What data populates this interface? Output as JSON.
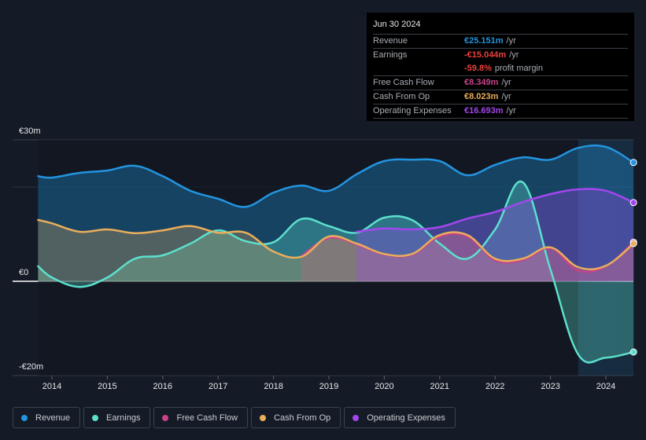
{
  "tooltip": {
    "date": "Jun 30 2024",
    "rows": [
      {
        "label": "Revenue",
        "value": "€25.151m",
        "unit": "/yr",
        "color": "#2394df"
      },
      {
        "label": "Earnings",
        "value": "-€15.044m",
        "unit": "/yr",
        "color": "#e8403e"
      },
      {
        "label": "",
        "value": "-59.8%",
        "unit": "profit margin",
        "color": "#e8403e"
      },
      {
        "label": "Free Cash Flow",
        "value": "€8.349m",
        "unit": "/yr",
        "color": "#c6428a"
      },
      {
        "label": "Cash From Op",
        "value": "€8.023m",
        "unit": "/yr",
        "color": "#e9ae5b"
      },
      {
        "label": "Operating Expenses",
        "value": "€16.693m",
        "unit": "/yr",
        "color": "#a346ee"
      }
    ]
  },
  "legend": [
    {
      "label": "Revenue",
      "color": "#2394df"
    },
    {
      "label": "Earnings",
      "color": "#5ce0cc"
    },
    {
      "label": "Free Cash Flow",
      "color": "#c6428a"
    },
    {
      "label": "Cash From Op",
      "color": "#e9ae5b"
    },
    {
      "label": "Operating Expenses",
      "color": "#a346ee"
    }
  ],
  "chart_data": {
    "type": "area",
    "title": "",
    "xlabel": "",
    "ylabel": "",
    "ylim": [
      -20,
      30
    ],
    "xlim": [
      2013.75,
      2024.5
    ],
    "y_tick_labels": [
      {
        "value": 30,
        "label": "€30m"
      },
      {
        "value": 0,
        "label": "€0"
      },
      {
        "value": -20,
        "label": "-€20m"
      }
    ],
    "gridlines": [
      30,
      20,
      0,
      -20
    ],
    "x_ticks": [
      2014,
      2015,
      2016,
      2017,
      2018,
      2019,
      2020,
      2021,
      2022,
      2023,
      2024
    ],
    "forecast_shade_start": 2023.5,
    "series": [
      {
        "name": "Revenue",
        "color": "#2394df",
        "x": [
          2013.75,
          2014.0,
          2014.5,
          2015.0,
          2015.5,
          2016.0,
          2016.5,
          2017.0,
          2017.5,
          2018.0,
          2018.5,
          2019.0,
          2019.5,
          2020.0,
          2020.5,
          2021.0,
          2021.5,
          2022.0,
          2022.5,
          2023.0,
          2023.5,
          2024.0,
          2024.5
        ],
        "values": [
          22.3,
          22.0,
          23.0,
          23.5,
          24.5,
          22.3,
          19.2,
          17.5,
          15.8,
          18.8,
          20.3,
          19.2,
          22.7,
          25.5,
          25.8,
          25.5,
          22.5,
          24.7,
          26.3,
          25.8,
          28.3,
          28.5,
          25.2
        ]
      },
      {
        "name": "Earnings",
        "color": "#5ce0cc",
        "x": [
          2013.75,
          2014.0,
          2014.5,
          2015.0,
          2015.5,
          2016.0,
          2016.5,
          2017.0,
          2017.5,
          2018.0,
          2018.5,
          2019.0,
          2019.5,
          2020.0,
          2020.5,
          2021.0,
          2021.5,
          2022.0,
          2022.5,
          2023.0,
          2023.5,
          2024.0,
          2024.5
        ],
        "values": [
          3.2,
          0.8,
          -1.2,
          0.8,
          4.8,
          5.5,
          8.0,
          10.8,
          8.5,
          8.3,
          13.2,
          11.7,
          10.3,
          13.5,
          13.0,
          8.0,
          4.8,
          11.0,
          21.0,
          2.5,
          -15.5,
          -16.2,
          -15.0
        ]
      },
      {
        "name": "Free Cash Flow",
        "color": "#c6428a",
        "x": [
          2018.5,
          2019.0,
          2019.5,
          2020.0,
          2020.5,
          2021.0,
          2021.5,
          2022.0,
          2022.5,
          2023.0,
          2023.5,
          2024.0,
          2024.5
        ],
        "values": [
          5.3,
          9.2,
          7.8,
          5.7,
          5.7,
          9.5,
          9.5,
          4.5,
          4.5,
          7.0,
          2.3,
          3.2,
          8.3
        ]
      },
      {
        "name": "Cash From Op",
        "color": "#e9ae5b",
        "x": [
          2013.75,
          2014.0,
          2014.5,
          2015.0,
          2015.5,
          2016.0,
          2016.5,
          2017.0,
          2017.5,
          2018.0,
          2018.5,
          2019.0,
          2019.5,
          2020.0,
          2020.5,
          2021.0,
          2021.5,
          2022.0,
          2022.5,
          2023.0,
          2023.5,
          2024.0,
          2024.5
        ],
        "values": [
          13.0,
          12.3,
          10.5,
          11.0,
          10.2,
          10.8,
          11.7,
          10.3,
          10.3,
          6.3,
          5.2,
          9.5,
          8.0,
          5.8,
          5.8,
          9.8,
          9.8,
          4.8,
          4.8,
          7.2,
          3.0,
          3.3,
          8.0
        ]
      },
      {
        "name": "Operating Expenses",
        "color": "#a346ee",
        "x": [
          2019.5,
          2020.0,
          2020.5,
          2021.0,
          2021.5,
          2022.0,
          2022.5,
          2023.0,
          2023.5,
          2024.0,
          2024.5
        ],
        "values": [
          10.5,
          11.2,
          11.0,
          11.5,
          13.3,
          14.7,
          16.8,
          18.5,
          19.5,
          19.2,
          16.7
        ]
      }
    ]
  }
}
